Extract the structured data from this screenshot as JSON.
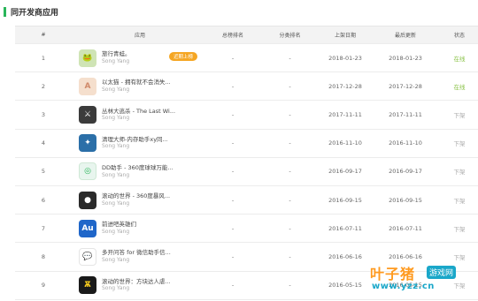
{
  "section": {
    "title": "同开发商应用"
  },
  "table": {
    "headers": {
      "index": "#",
      "app": "应用",
      "total_rank": "总榜排名",
      "category_rank": "分类排名",
      "listed_date": "上架日期",
      "updated": "最后更新",
      "status": "状态"
    },
    "rows": [
      {
        "index": "1",
        "name": "旅行青蛙。",
        "developer": "Song Yang",
        "badge": "近期上榜",
        "total_rank": "-",
        "category_rank": "-",
        "listed_date": "2018-01-23",
        "updated": "2018-01-23",
        "status": "在线",
        "icon": "frog-app-icon",
        "icon_glyph": "🐸"
      },
      {
        "index": "2",
        "name": "以太猫 - 拥有就不会消失...",
        "developer": "Song Yang",
        "total_rank": "-",
        "category_rank": "-",
        "listed_date": "2017-12-28",
        "updated": "2017-12-28",
        "status": "在线",
        "icon": "cat-app-icon",
        "icon_glyph": "A"
      },
      {
        "index": "3",
        "name": "丛林大逃杀 - The Last Wi...",
        "developer": "Song Yang",
        "total_rank": "-",
        "category_rank": "-",
        "listed_date": "2017-11-11",
        "updated": "2017-11-11",
        "status": "下架",
        "icon": "soldier-app-icon",
        "icon_glyph": "⚔"
      },
      {
        "index": "4",
        "name": "清理大师-内存助手xy同...",
        "developer": "Song Yang",
        "total_rank": "-",
        "category_rank": "-",
        "listed_date": "2016-11-10",
        "updated": "2016-11-10",
        "status": "下架",
        "icon": "cleaner-app-icon",
        "icon_glyph": "✦"
      },
      {
        "index": "5",
        "name": "DD助手 - 360度球球万能...",
        "developer": "Song Yang",
        "total_rank": "-",
        "category_rank": "-",
        "listed_date": "2016-09-17",
        "updated": "2016-09-17",
        "status": "下架",
        "icon": "ball-app-icon",
        "icon_glyph": "◎"
      },
      {
        "index": "6",
        "name": "滚动的世界 - 360度暴风...",
        "developer": "Song Yang",
        "total_rank": "-",
        "category_rank": "-",
        "listed_date": "2016-09-15",
        "updated": "2016-09-15",
        "status": "下架",
        "icon": "dark-hero-app-icon",
        "icon_glyph": "●"
      },
      {
        "index": "7",
        "name": "前进吧英雄们",
        "developer": "Song Yang",
        "total_rank": "-",
        "category_rank": "-",
        "listed_date": "2016-07-11",
        "updated": "2016-07-11",
        "status": "下架",
        "icon": "au-app-icon",
        "icon_glyph": "Au"
      },
      {
        "index": "8",
        "name": "多开问答 for 微信助手信...",
        "developer": "Song Yang",
        "total_rank": "-",
        "category_rank": "-",
        "listed_date": "2016-06-16",
        "updated": "2016-06-16",
        "status": "下架",
        "icon": "chat-app-icon",
        "icon_glyph": "💬"
      },
      {
        "index": "9",
        "name": "滚动的世界：方块达人虐...",
        "developer": "Song Yang",
        "total_rank": "-",
        "category_rank": "-",
        "listed_date": "2016-05-15",
        "updated": "2016-05-15",
        "status": "下架",
        "icon": "yb-app-icon",
        "icon_glyph": "Ѫ"
      }
    ]
  },
  "watermark": {
    "main": "叶子猪",
    "tag": "游戏网",
    "url": "www.yzz.cn"
  },
  "colors": {
    "accent": "#2ab55a",
    "online": "#8bc34a",
    "offline": "#aaaaaa",
    "badge": "#f5a623"
  }
}
